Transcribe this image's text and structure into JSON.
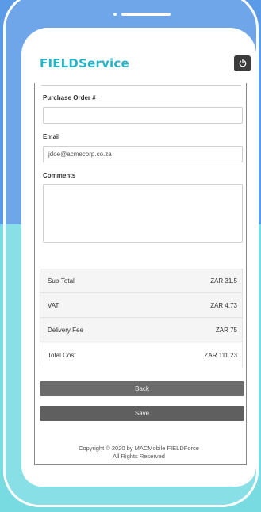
{
  "app": {
    "brand": "FIELDService",
    "power_icon": "power-icon"
  },
  "form": {
    "purchase_order": {
      "label": "Purchase Order #",
      "value": "",
      "placeholder": ""
    },
    "email": {
      "label": "Email",
      "value": "jdoe@acmecorp.co.za"
    },
    "comments": {
      "label": "Comments",
      "value": ""
    }
  },
  "totals": {
    "rows": [
      {
        "label": "Sub-Total",
        "value": "ZAR 31.5"
      },
      {
        "label": "VAT",
        "value": "ZAR 4.73"
      },
      {
        "label": "Delivery Fee",
        "value": "ZAR 75"
      },
      {
        "label": "Total Cost",
        "value": "ZAR 111.23"
      }
    ]
  },
  "buttons": {
    "back": "Back",
    "save": "Save"
  },
  "footer": {
    "copyright": "Copyright © 2020 by MACMobile FIELDForce",
    "rights": "All Rights Reserved"
  },
  "colors": {
    "brand": "#26b4c8",
    "bg_top": "#5a9ae6",
    "bg_bottom": "#78dbe2",
    "button": "#6b6b6b"
  }
}
